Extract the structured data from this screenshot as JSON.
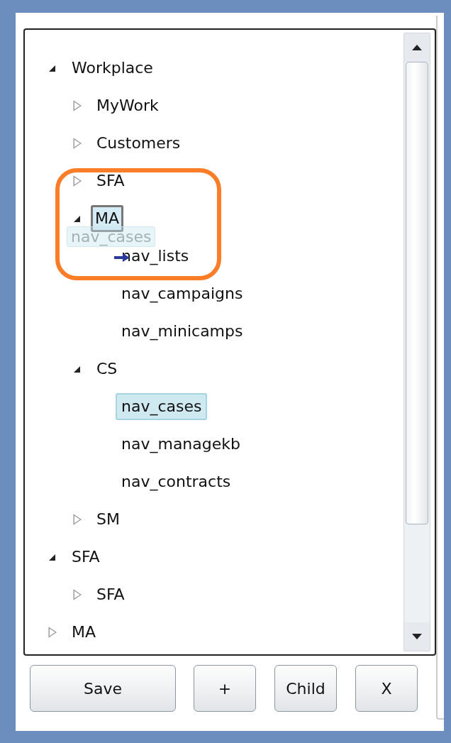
{
  "tree": [
    {
      "label": "Workplace",
      "expanded": true,
      "children": [
        {
          "label": "MyWork",
          "expanded": false
        },
        {
          "label": "Customers",
          "expanded": false
        },
        {
          "label": "SFA",
          "expanded": false
        },
        {
          "label": "MA",
          "expanded": true,
          "drop_target": true,
          "children": [
            {
              "label": "nav_lists"
            },
            {
              "label": "nav_campaigns"
            },
            {
              "label": "nav_minicamps"
            }
          ]
        },
        {
          "label": "CS",
          "expanded": true,
          "children": [
            {
              "label": "nav_cases",
              "selected": true
            },
            {
              "label": "nav_managekb",
              "selected": false
            },
            {
              "label": "nav_contracts",
              "selected": false
            }
          ]
        },
        {
          "label": "SM",
          "expanded": false
        }
      ]
    },
    {
      "label": "SFA",
      "expanded": true,
      "children": [
        {
          "label": "SFA",
          "expanded": false
        }
      ]
    },
    {
      "label": "MA",
      "expanded": false
    }
  ],
  "drag_ghost": {
    "label": "nav_cases"
  },
  "buttons": [
    "Save",
    "+",
    "Child",
    "X"
  ]
}
